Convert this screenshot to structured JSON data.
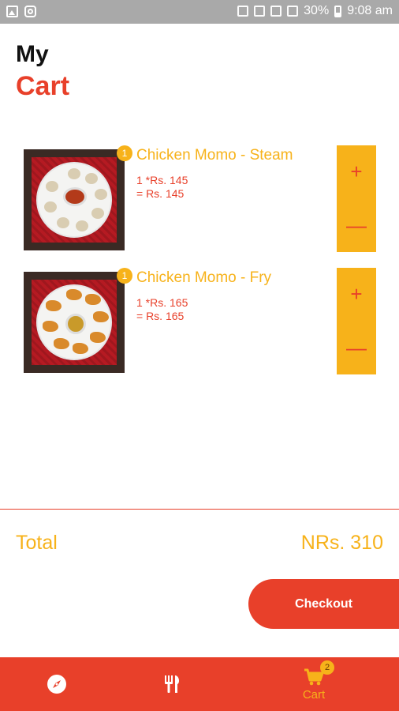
{
  "status_bar": {
    "battery": "30%",
    "time": "9:08 am"
  },
  "header": {
    "title_line1": "My",
    "title_line2": "Cart"
  },
  "cart": {
    "items": [
      {
        "qty": "1",
        "name": "Chicken Momo - Steam",
        "unit_line": "1 *Rs. 145",
        "total_line": "= Rs. 145",
        "plus": "+",
        "minus": "—"
      },
      {
        "qty": "1",
        "name": "Chicken Momo - Fry",
        "unit_line": "1 *Rs. 165",
        "total_line": "= Rs. 165",
        "plus": "+",
        "minus": "—"
      }
    ]
  },
  "summary": {
    "total_label": "Total",
    "total_value": "NRs. 310"
  },
  "checkout": {
    "label": "Checkout"
  },
  "bottom_nav": {
    "cart_label": "Cart",
    "cart_count": "2",
    "icons": [
      "compass-icon",
      "fork-knife-icon",
      "cart-icon"
    ]
  },
  "colors": {
    "primary": "#e8402a",
    "accent": "#f7b21a",
    "status_bar": "#a9a9a9"
  }
}
